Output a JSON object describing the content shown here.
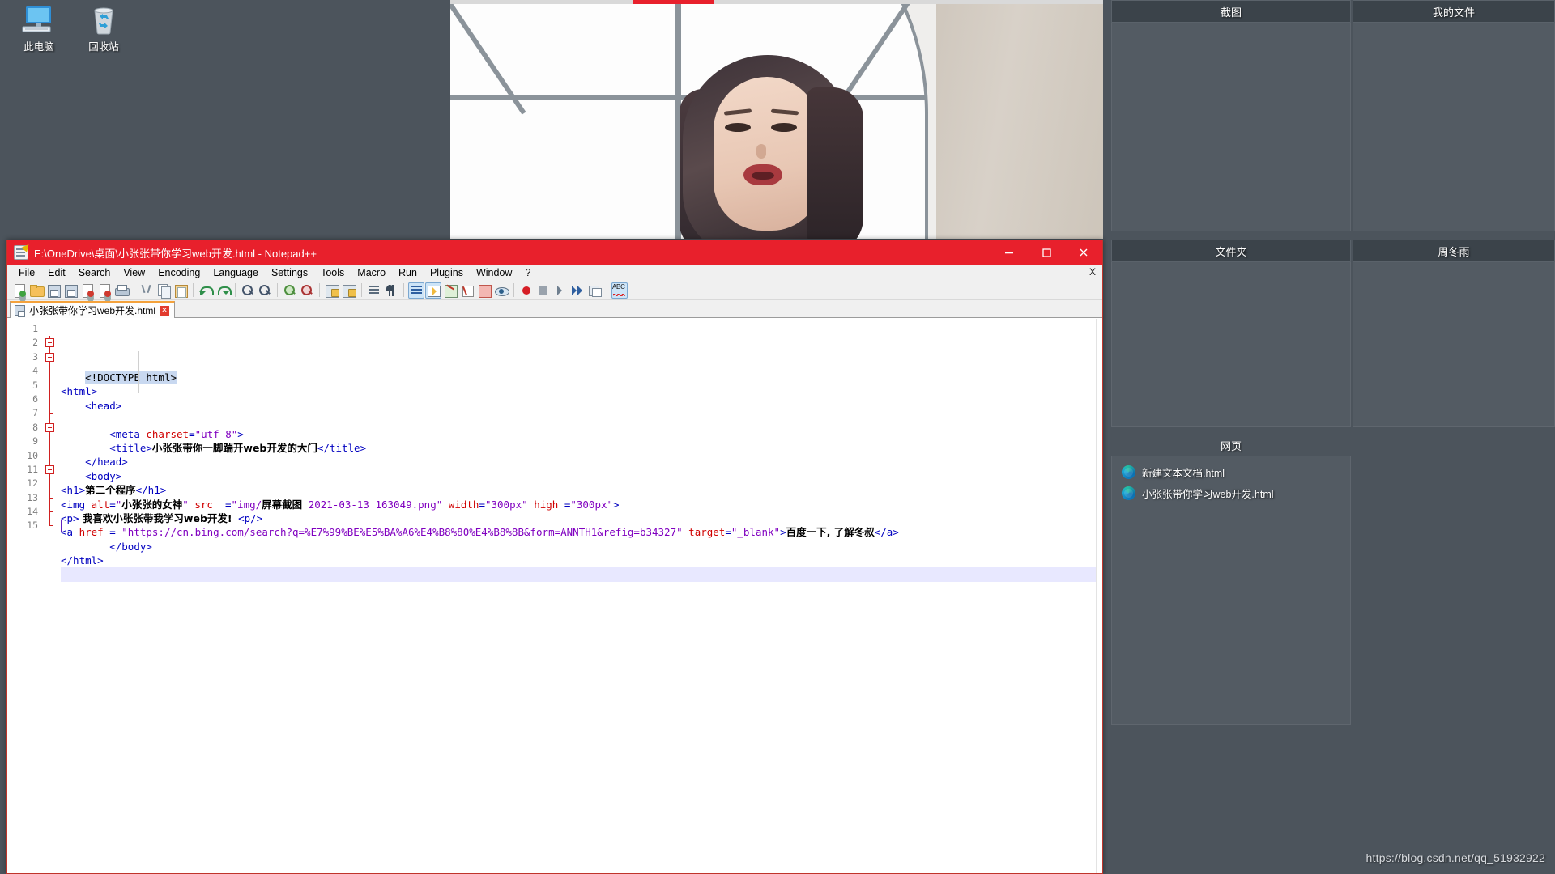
{
  "desktop": {
    "icons": [
      {
        "label": "此电脑",
        "icon": "this-pc-icon"
      },
      {
        "label": "回收站",
        "icon": "recycle-bin-icon"
      }
    ]
  },
  "notepadpp": {
    "title": "E:\\OneDrive\\桌面\\小张张带你学习web开发.html - Notepad++",
    "title_color": "#e8202c",
    "window_buttons": {
      "minimize": "—",
      "maximize": "□",
      "close": "✕"
    },
    "menu": {
      "items": [
        "File",
        "Edit",
        "Search",
        "View",
        "Encoding",
        "Language",
        "Settings",
        "Tools",
        "Macro",
        "Run",
        "Plugins",
        "Window",
        "?"
      ],
      "close_doc": "X"
    },
    "toolbar": {
      "icons": [
        "new-file-icon",
        "open-file-icon",
        "save-icon",
        "save-all-icon",
        "close-file-icon",
        "close-all-icon",
        "print-icon",
        "cut-icon",
        "copy-icon",
        "paste-icon",
        "undo-icon",
        "redo-icon",
        "find-icon",
        "replace-icon",
        "zoom-in-icon",
        "zoom-out-icon",
        "sync-vertical-icon",
        "sync-horizontal-icon",
        "word-wrap-icon",
        "show-all-characters-icon",
        "indent-guideline-icon",
        "user-defined-language-icon",
        "document-map-icon",
        "function-list-icon",
        "folder-as-workspace-icon",
        "monitoring-icon",
        "start-recording-icon",
        "stop-recording-icon",
        "play-macro-icon",
        "run-macro-multiple-icon",
        "save-macro-icon",
        "spell-check-icon"
      ]
    },
    "tab": {
      "label": "小张张带你学习web开发.html",
      "close": "✕"
    },
    "editor": {
      "line_numbers": [
        "1",
        "2",
        "3",
        "4",
        "5",
        "6",
        "7",
        "8",
        "9",
        "10",
        "11",
        "12",
        "13",
        "14",
        "15"
      ],
      "current_line": 15,
      "lines": [
        {
          "n": 1,
          "segs": [
            {
              "t": "    ",
              "c": ""
            },
            {
              "t": "<!DOCTYPE html>",
              "c": "doc"
            }
          ]
        },
        {
          "n": 2,
          "segs": [
            {
              "t": "<html>",
              "c": "tg"
            }
          ]
        },
        {
          "n": 3,
          "segs": [
            {
              "t": "    ",
              "c": ""
            },
            {
              "t": "<head>",
              "c": "tg"
            }
          ]
        },
        {
          "n": 4,
          "segs": [
            {
              "t": "",
              "c": ""
            }
          ]
        },
        {
          "n": 5,
          "segs": [
            {
              "t": "        ",
              "c": ""
            },
            {
              "t": "<meta ",
              "c": "tg"
            },
            {
              "t": "charset",
              "c": "at"
            },
            {
              "t": "=",
              "c": "tg"
            },
            {
              "t": "\"utf-8\"",
              "c": "vl"
            },
            {
              "t": ">",
              "c": "tg"
            }
          ]
        },
        {
          "n": 6,
          "segs": [
            {
              "t": "        ",
              "c": ""
            },
            {
              "t": "<title>",
              "c": "tg"
            },
            {
              "t": "小张张带你一脚踹开web开发的大门",
              "c": "tx"
            },
            {
              "t": "</title>",
              "c": "tg"
            }
          ]
        },
        {
          "n": 7,
          "segs": [
            {
              "t": "    ",
              "c": ""
            },
            {
              "t": "</head>",
              "c": "tg"
            }
          ]
        },
        {
          "n": 8,
          "segs": [
            {
              "t": "    ",
              "c": ""
            },
            {
              "t": "<body>",
              "c": "tg"
            }
          ]
        },
        {
          "n": 9,
          "segs": [
            {
              "t": "<h1>",
              "c": "tg"
            },
            {
              "t": "第二个程序",
              "c": "tx"
            },
            {
              "t": "</h1>",
              "c": "tg"
            }
          ]
        },
        {
          "n": 10,
          "segs": [
            {
              "t": "<img ",
              "c": "tg"
            },
            {
              "t": "alt",
              "c": "at"
            },
            {
              "t": "=",
              "c": "tg"
            },
            {
              "t": "\"",
              "c": "vl"
            },
            {
              "t": "小张张的女神",
              "c": "tx2"
            },
            {
              "t": "\" ",
              "c": "vl"
            },
            {
              "t": "src",
              "c": "at"
            },
            {
              "t": "  =",
              "c": "tg"
            },
            {
              "t": "\"img/",
              "c": "vl"
            },
            {
              "t": "屏幕截图",
              "c": "tx2"
            },
            {
              "t": " 2021-03-13 163049.png\" ",
              "c": "vl"
            },
            {
              "t": "width",
              "c": "at"
            },
            {
              "t": "=",
              "c": "tg"
            },
            {
              "t": "\"300px\" ",
              "c": "vl"
            },
            {
              "t": "high",
              "c": "at"
            },
            {
              "t": " =",
              "c": "tg"
            },
            {
              "t": "\"300px\"",
              "c": "vl"
            },
            {
              "t": ">",
              "c": "tg"
            }
          ]
        },
        {
          "n": 11,
          "segs": [
            {
              "t": "<p>",
              "c": "tg"
            },
            {
              "t": " 我喜欢小张张带我学习web开发!",
              "c": "tx"
            },
            {
              "t": " <p/>",
              "c": "tg"
            }
          ]
        },
        {
          "n": 12,
          "segs": [
            {
              "t": "<a ",
              "c": "tg"
            },
            {
              "t": "href",
              "c": "at"
            },
            {
              "t": " = ",
              "c": "tg"
            },
            {
              "t": "\"",
              "c": "vl"
            },
            {
              "t": "https://cn.bing.com/search?q=%E7%99%BE%E5%BA%A6%E4%B8%80%E4%B8%8B&form=ANNTH1&refig=b34327",
              "c": "lnk"
            },
            {
              "t": "\" ",
              "c": "vl"
            },
            {
              "t": "target",
              "c": "at"
            },
            {
              "t": "=",
              "c": "tg"
            },
            {
              "t": "\"_blank\"",
              "c": "vl"
            },
            {
              "t": ">",
              "c": "tg"
            },
            {
              "t": "百度一下, 了解冬叔",
              "c": "tx"
            },
            {
              "t": "</a>",
              "c": "tg"
            }
          ]
        },
        {
          "n": 13,
          "segs": [
            {
              "t": "        ",
              "c": ""
            },
            {
              "t": "</body>",
              "c": "tg"
            }
          ]
        },
        {
          "n": 14,
          "segs": [
            {
              "t": "</html>",
              "c": "tg"
            }
          ]
        },
        {
          "n": 15,
          "segs": [
            {
              "t": "",
              "c": ""
            }
          ]
        }
      ]
    }
  },
  "sidebar": {
    "fences": [
      {
        "name": "screenshots",
        "title": "截图",
        "items": []
      },
      {
        "name": "my-files",
        "title": "我的文件",
        "items": []
      },
      {
        "name": "folders",
        "title": "文件夹",
        "items": []
      },
      {
        "name": "zhou-dongyu",
        "title": "周冬雨",
        "items": []
      },
      {
        "name": "webpages",
        "title": "网页",
        "items": [
          {
            "label": "新建文本文档.html",
            "icon": "edge-browser-icon"
          },
          {
            "label": "小张张带你学习web开发.html",
            "icon": "edge-browser-icon"
          }
        ]
      }
    ]
  },
  "watermark": {
    "text": "https://blog.csdn.net/qq_51932922"
  }
}
